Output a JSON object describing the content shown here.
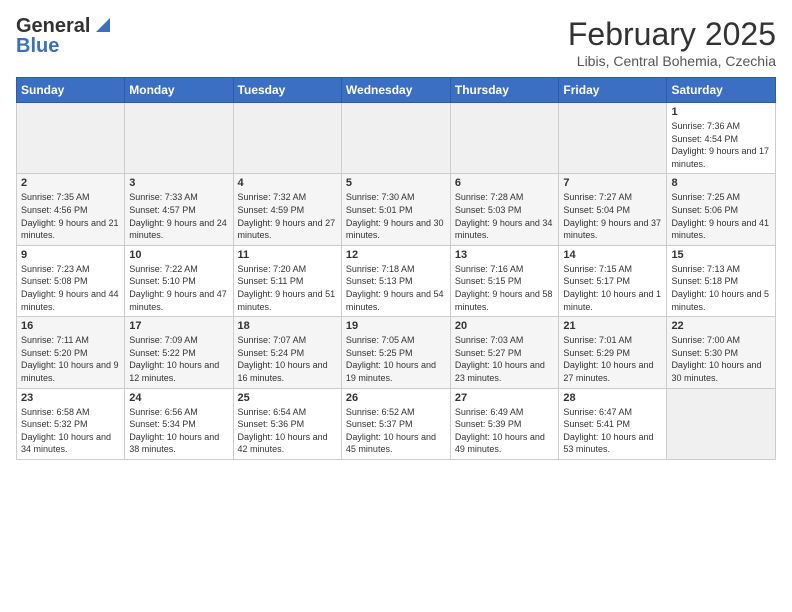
{
  "header": {
    "logo_general": "General",
    "logo_blue": "Blue",
    "month_title": "February 2025",
    "subtitle": "Libis, Central Bohemia, Czechia"
  },
  "days_of_week": [
    "Sunday",
    "Monday",
    "Tuesday",
    "Wednesday",
    "Thursday",
    "Friday",
    "Saturday"
  ],
  "weeks": [
    [
      {
        "num": "",
        "info": ""
      },
      {
        "num": "",
        "info": ""
      },
      {
        "num": "",
        "info": ""
      },
      {
        "num": "",
        "info": ""
      },
      {
        "num": "",
        "info": ""
      },
      {
        "num": "",
        "info": ""
      },
      {
        "num": "1",
        "info": "Sunrise: 7:36 AM\nSunset: 4:54 PM\nDaylight: 9 hours and 17 minutes."
      }
    ],
    [
      {
        "num": "2",
        "info": "Sunrise: 7:35 AM\nSunset: 4:56 PM\nDaylight: 9 hours and 21 minutes."
      },
      {
        "num": "3",
        "info": "Sunrise: 7:33 AM\nSunset: 4:57 PM\nDaylight: 9 hours and 24 minutes."
      },
      {
        "num": "4",
        "info": "Sunrise: 7:32 AM\nSunset: 4:59 PM\nDaylight: 9 hours and 27 minutes."
      },
      {
        "num": "5",
        "info": "Sunrise: 7:30 AM\nSunset: 5:01 PM\nDaylight: 9 hours and 30 minutes."
      },
      {
        "num": "6",
        "info": "Sunrise: 7:28 AM\nSunset: 5:03 PM\nDaylight: 9 hours and 34 minutes."
      },
      {
        "num": "7",
        "info": "Sunrise: 7:27 AM\nSunset: 5:04 PM\nDaylight: 9 hours and 37 minutes."
      },
      {
        "num": "8",
        "info": "Sunrise: 7:25 AM\nSunset: 5:06 PM\nDaylight: 9 hours and 41 minutes."
      }
    ],
    [
      {
        "num": "9",
        "info": "Sunrise: 7:23 AM\nSunset: 5:08 PM\nDaylight: 9 hours and 44 minutes."
      },
      {
        "num": "10",
        "info": "Sunrise: 7:22 AM\nSunset: 5:10 PM\nDaylight: 9 hours and 47 minutes."
      },
      {
        "num": "11",
        "info": "Sunrise: 7:20 AM\nSunset: 5:11 PM\nDaylight: 9 hours and 51 minutes."
      },
      {
        "num": "12",
        "info": "Sunrise: 7:18 AM\nSunset: 5:13 PM\nDaylight: 9 hours and 54 minutes."
      },
      {
        "num": "13",
        "info": "Sunrise: 7:16 AM\nSunset: 5:15 PM\nDaylight: 9 hours and 58 minutes."
      },
      {
        "num": "14",
        "info": "Sunrise: 7:15 AM\nSunset: 5:17 PM\nDaylight: 10 hours and 1 minute."
      },
      {
        "num": "15",
        "info": "Sunrise: 7:13 AM\nSunset: 5:18 PM\nDaylight: 10 hours and 5 minutes."
      }
    ],
    [
      {
        "num": "16",
        "info": "Sunrise: 7:11 AM\nSunset: 5:20 PM\nDaylight: 10 hours and 9 minutes."
      },
      {
        "num": "17",
        "info": "Sunrise: 7:09 AM\nSunset: 5:22 PM\nDaylight: 10 hours and 12 minutes."
      },
      {
        "num": "18",
        "info": "Sunrise: 7:07 AM\nSunset: 5:24 PM\nDaylight: 10 hours and 16 minutes."
      },
      {
        "num": "19",
        "info": "Sunrise: 7:05 AM\nSunset: 5:25 PM\nDaylight: 10 hours and 19 minutes."
      },
      {
        "num": "20",
        "info": "Sunrise: 7:03 AM\nSunset: 5:27 PM\nDaylight: 10 hours and 23 minutes."
      },
      {
        "num": "21",
        "info": "Sunrise: 7:01 AM\nSunset: 5:29 PM\nDaylight: 10 hours and 27 minutes."
      },
      {
        "num": "22",
        "info": "Sunrise: 7:00 AM\nSunset: 5:30 PM\nDaylight: 10 hours and 30 minutes."
      }
    ],
    [
      {
        "num": "23",
        "info": "Sunrise: 6:58 AM\nSunset: 5:32 PM\nDaylight: 10 hours and 34 minutes."
      },
      {
        "num": "24",
        "info": "Sunrise: 6:56 AM\nSunset: 5:34 PM\nDaylight: 10 hours and 38 minutes."
      },
      {
        "num": "25",
        "info": "Sunrise: 6:54 AM\nSunset: 5:36 PM\nDaylight: 10 hours and 42 minutes."
      },
      {
        "num": "26",
        "info": "Sunrise: 6:52 AM\nSunset: 5:37 PM\nDaylight: 10 hours and 45 minutes."
      },
      {
        "num": "27",
        "info": "Sunrise: 6:49 AM\nSunset: 5:39 PM\nDaylight: 10 hours and 49 minutes."
      },
      {
        "num": "28",
        "info": "Sunrise: 6:47 AM\nSunset: 5:41 PM\nDaylight: 10 hours and 53 minutes."
      },
      {
        "num": "",
        "info": ""
      }
    ]
  ]
}
